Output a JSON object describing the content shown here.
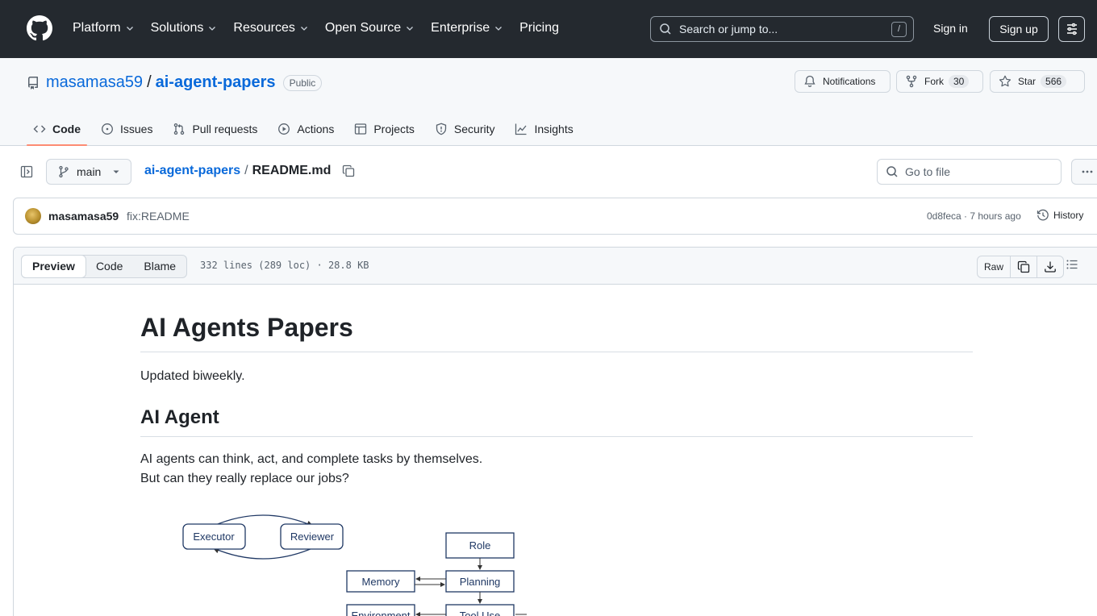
{
  "header": {
    "nav": [
      {
        "label": "Platform",
        "has_menu": true
      },
      {
        "label": "Solutions",
        "has_menu": true
      },
      {
        "label": "Resources",
        "has_menu": true
      },
      {
        "label": "Open Source",
        "has_menu": true
      },
      {
        "label": "Enterprise",
        "has_menu": true
      },
      {
        "label": "Pricing",
        "has_menu": false
      }
    ],
    "search_placeholder": "Search or jump to...",
    "search_shortcut": "/",
    "signin": "Sign in",
    "signup": "Sign up"
  },
  "repo": {
    "owner": "masamasa59",
    "separator": "/",
    "name": "ai-agent-papers",
    "visibility": "Public",
    "notifications": "Notifications",
    "fork_label": "Fork",
    "fork_count": "30",
    "star_label": "Star",
    "star_count": "566",
    "tabs": [
      "Code",
      "Issues",
      "Pull requests",
      "Actions",
      "Projects",
      "Security",
      "Insights"
    ]
  },
  "file_nav": {
    "branch": "main",
    "crumb_repo": "ai-agent-papers",
    "crumb_sep": "/",
    "crumb_file": "README.md",
    "goto_placeholder": "Go to file"
  },
  "commit": {
    "author": "masamasa59",
    "message": "fix:README",
    "meta": "0d8feca · 7 hours ago",
    "history": "History"
  },
  "viewer": {
    "modes": [
      "Preview",
      "Code",
      "Blame"
    ],
    "active_mode": "Preview",
    "fileinfo": "332 lines (289 loc) · 28.8 KB",
    "raw": "Raw"
  },
  "readme": {
    "h1": "AI Agents Papers",
    "p1": "Updated biweekly.",
    "h2": "AI Agent",
    "p2_line1": "AI agents can think, act, and complete tasks by themselves.",
    "p2_line2": "But can they really replace our jobs?"
  },
  "diagram": {
    "executor": "Executor",
    "reviewer": "Reviewer",
    "role": "Role",
    "memory": "Memory",
    "planning": "Planning",
    "environment": "Environment",
    "tool_use": "Tool Use"
  },
  "colors": {
    "header_bg": "#24292f",
    "link": "#0969da",
    "active_tab_underline": "#fd8c73",
    "diagram_text": "#1f3864"
  }
}
